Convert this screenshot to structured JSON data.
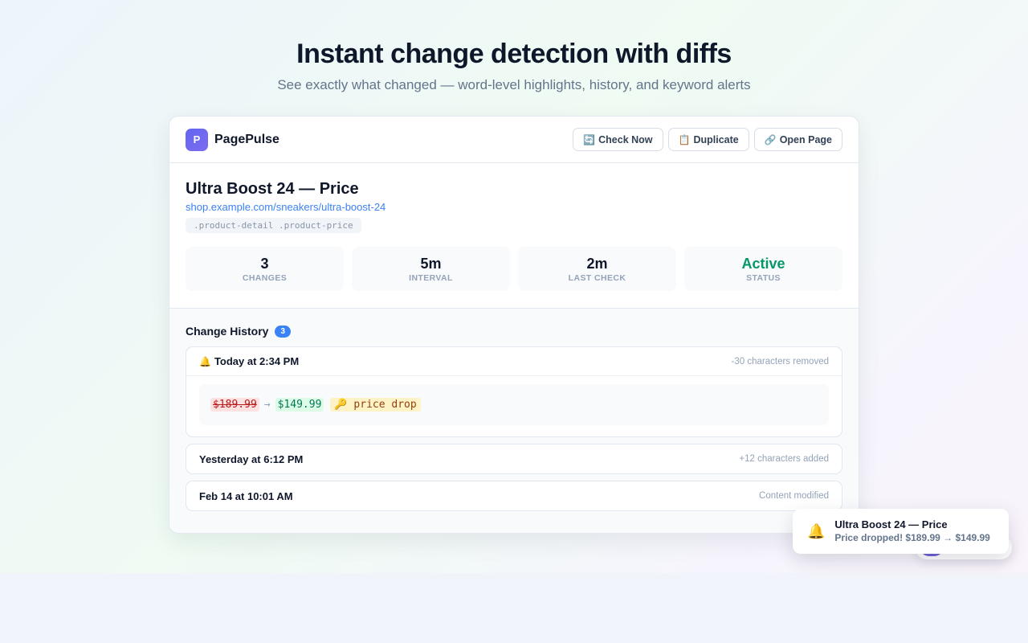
{
  "hero": {
    "headline": "Instant change detection with diffs",
    "subline": "See exactly what changed — word-level highlights, history, and keyword alerts"
  },
  "header": {
    "logo_letter": "P",
    "brand": "PagePulse",
    "buttons": [
      {
        "icon": "🔄",
        "label": "Check Now"
      },
      {
        "icon": "📋",
        "label": "Duplicate"
      },
      {
        "icon": "🔗",
        "label": "Open Page"
      }
    ]
  },
  "monitor": {
    "title": "Ultra Boost 24 — Price",
    "url": "shop.example.com/sneakers/ultra-boost-24",
    "selector": ".product-detail .product-price",
    "stats": [
      {
        "value": "3",
        "label": "CHANGES"
      },
      {
        "value": "5m",
        "label": "INTERVAL"
      },
      {
        "value": "2m",
        "label": "LAST CHECK"
      },
      {
        "value": "Active",
        "label": "STATUS"
      }
    ]
  },
  "history": {
    "title": "Change History",
    "count": "3",
    "entries": [
      {
        "icon": "🔔",
        "time": "Today at 2:34 PM",
        "meta": "-30 characters removed",
        "diff": {
          "removed": "$189.99",
          "arrow": "→",
          "added": "$149.99",
          "keyword": "🔑 price drop"
        }
      },
      {
        "time": "Yesterday at 6:12 PM",
        "meta": "+12 characters added"
      },
      {
        "time": "Feb 14 at 10:01 AM",
        "meta": "Content modified"
      }
    ]
  },
  "toast": {
    "icon": "🔔",
    "title": "Ultra Boost 24 — Price",
    "message": "Price dropped! $189.99 → $149.99"
  },
  "colors": {
    "accent": "#3b82f6",
    "active": "#059669",
    "removed_bg": "#fde2e2",
    "added_bg": "#dcfce7",
    "keyword_bg": "#fef3c7"
  }
}
